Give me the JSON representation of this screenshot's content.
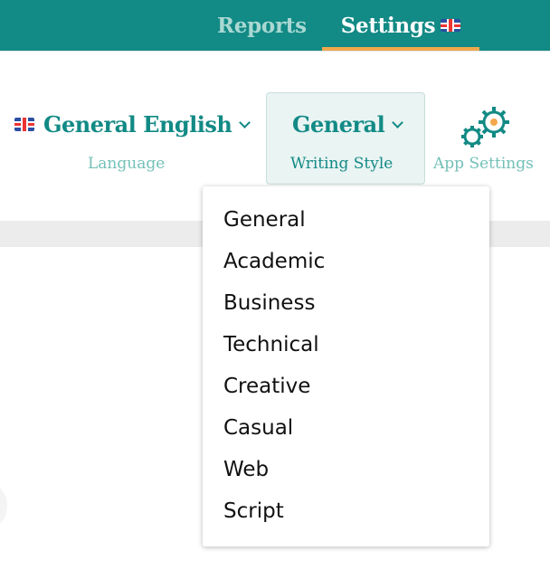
{
  "nav": {
    "tabs": [
      {
        "label": "Reports"
      },
      {
        "label": "Settings"
      }
    ],
    "active_tab": "Settings"
  },
  "toolbar": {
    "language": {
      "value": "General English",
      "label": "Language"
    },
    "writing_style": {
      "value": "General",
      "label": "Writing Style"
    },
    "app_settings": {
      "label": "App Settings"
    }
  },
  "dropdown": {
    "items": [
      "General",
      "Academic",
      "Business",
      "Technical",
      "Creative",
      "Casual",
      "Web",
      "Script"
    ]
  },
  "colors": {
    "brand": "#128a85",
    "accent": "#f2a74b",
    "muted": "#74c0b8"
  },
  "icons": {
    "language": "uk-flag-icon",
    "chevron": "chevron-down-icon",
    "app_settings": "gears-icon"
  }
}
